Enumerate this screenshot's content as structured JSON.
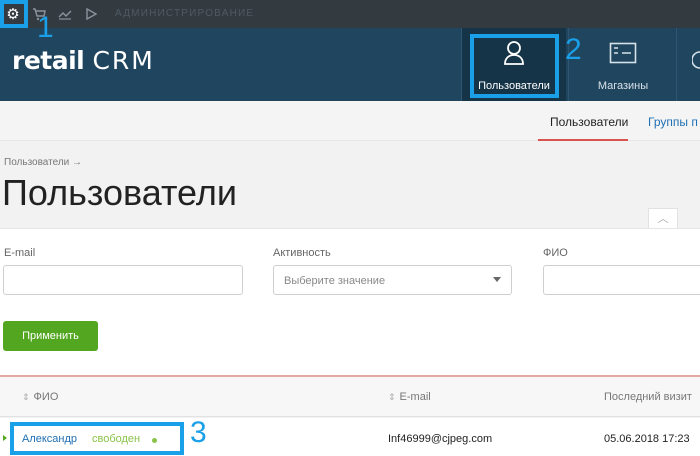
{
  "admin_bar": {
    "label": "АДМИНИСТРИРОВАНИЕ",
    "icons": [
      "gear-icon",
      "cart-icon",
      "chart-icon",
      "play-icon"
    ]
  },
  "annotations": {
    "n1": "1",
    "n2": "2",
    "n3": "3",
    "highlight_color": "#1aa0e8"
  },
  "logo": {
    "retail": "retail",
    "crm": "CRM"
  },
  "nav": {
    "users": "Пользователи",
    "shops": "Магазины"
  },
  "subtabs": {
    "users": "Пользователи",
    "groups": "Группы п"
  },
  "breadcrumb": "Пользователи →",
  "page_title": "Пользователи",
  "filters": {
    "email_label": "E-mail",
    "activity_label": "Активность",
    "activity_placeholder": "Выберите значение",
    "fio_label": "ФИО",
    "apply_label": "Применить"
  },
  "table": {
    "headers": {
      "fio": "ФИО",
      "email": "E-mail",
      "last_visit": "Последний визит"
    },
    "rows": [
      {
        "name": "Александр",
        "status": "свободен",
        "email": "Inf46999@cjpeg.com",
        "last_visit": "05.06.2018 17:23"
      }
    ]
  },
  "colors": {
    "header_bg": "#20455f",
    "admin_bar_bg": "#333a40",
    "apply_button": "#52a620",
    "status_free": "#8bc34a",
    "link": "#1f6fb3"
  }
}
